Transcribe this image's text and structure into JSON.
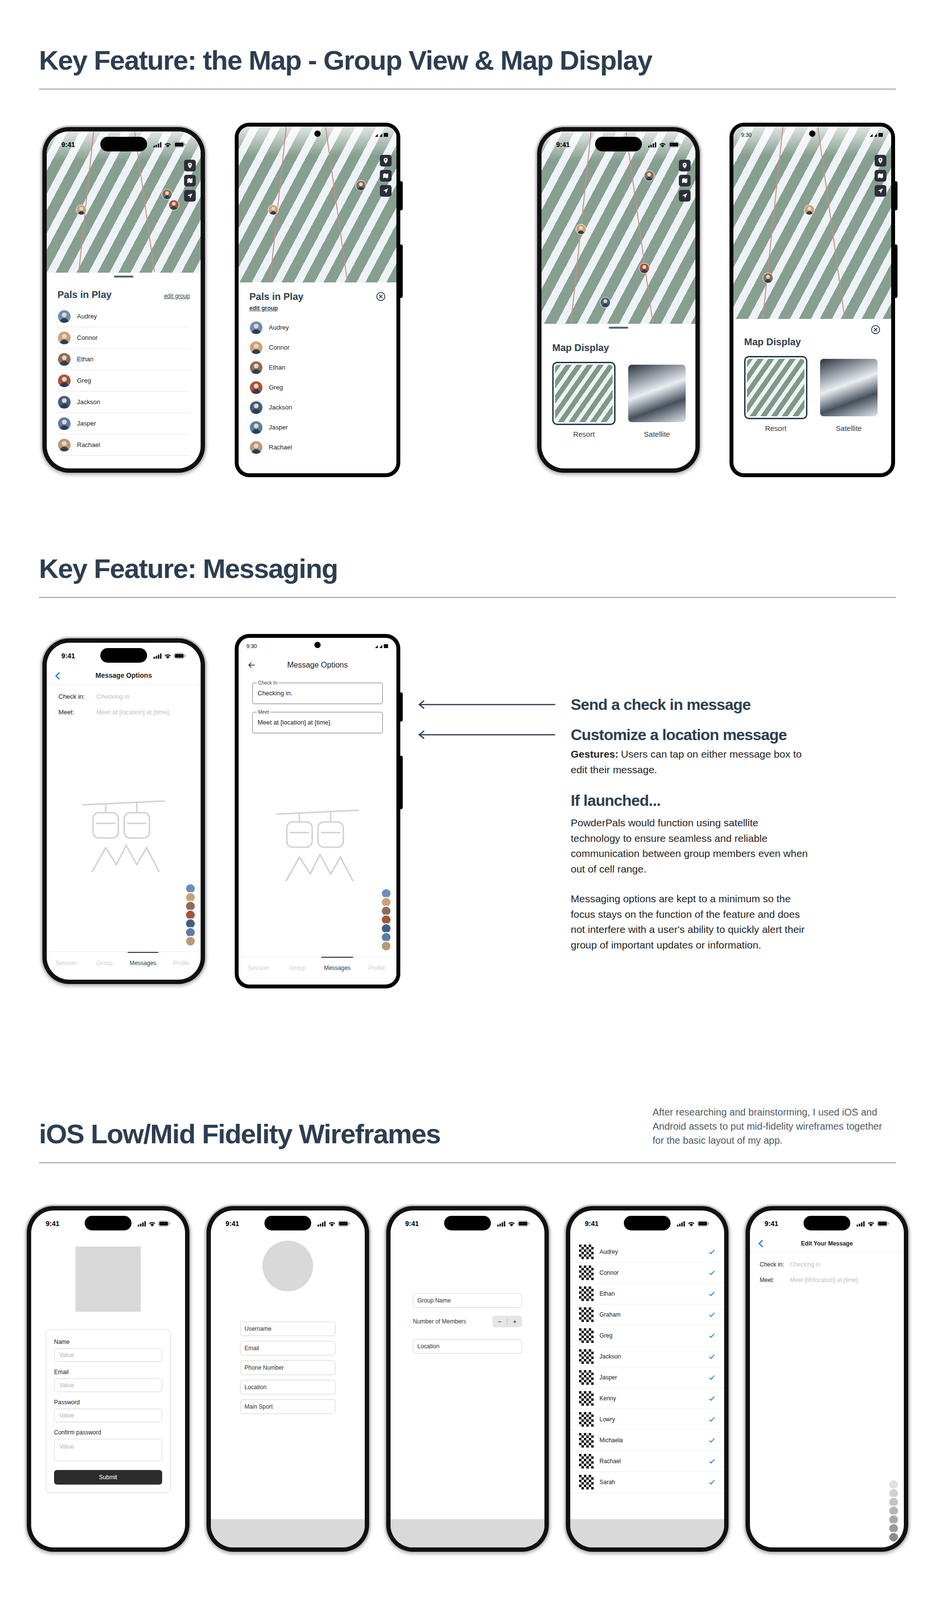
{
  "map_section": {
    "title": "Key Feature: the Map - Group View & Map Display",
    "phones": [
      {
        "kind": "ios",
        "view": "group",
        "status_time": "9:41",
        "sheet_title": "Pals in Play",
        "edit_link": "edit group",
        "members": [
          "Audrey",
          "Connor",
          "Ethan",
          "Greg",
          "Jackson",
          "Jasper",
          "Rachael"
        ]
      },
      {
        "kind": "android",
        "view": "group",
        "sheet_title": "Pals in Play",
        "edit_link": "edit group",
        "members": [
          "Audrey",
          "Connor",
          "Ethan",
          "Greg",
          "Jackson",
          "Jasper",
          "Rachael"
        ]
      },
      {
        "kind": "ios",
        "view": "display",
        "status_time": "9:41",
        "sheet_title": "Map Display",
        "options": [
          {
            "label": "Resort",
            "selected": true
          },
          {
            "label": "Satellite",
            "selected": false
          }
        ]
      },
      {
        "kind": "android",
        "view": "display",
        "status_time": "9:30",
        "sheet_title": "Map Display",
        "options": [
          {
            "label": "Resort",
            "selected": true
          },
          {
            "label": "Satellite",
            "selected": false
          }
        ]
      }
    ]
  },
  "messaging_section": {
    "title": "Key Feature: Messaging",
    "phones": [
      {
        "kind": "ios",
        "status_time": "9:41",
        "header": "Message Options",
        "fields": [
          {
            "label": "Check in:",
            "placeholder": "Checking in."
          },
          {
            "label": "Meet:",
            "placeholder": "Meet at [location] at [time]."
          }
        ],
        "tabs": [
          {
            "label": "Session",
            "selected": false
          },
          {
            "label": "Group",
            "selected": false
          },
          {
            "label": "Messages",
            "selected": true
          },
          {
            "label": "Profile",
            "selected": false
          }
        ]
      },
      {
        "kind": "android",
        "status_time": "9:30",
        "header": "Message Options",
        "fields": [
          {
            "label": "Check In",
            "value": "Checking in."
          },
          {
            "label": "Meet",
            "value": "Meet at [location] at [time]."
          }
        ],
        "tabs": [
          {
            "label": "Session",
            "selected": false
          },
          {
            "label": "Group",
            "selected": false
          },
          {
            "label": "Messages",
            "selected": true
          },
          {
            "label": "Profile",
            "selected": false
          }
        ]
      }
    ],
    "annotations": {
      "callouts": [
        "Send a check in message",
        "Customize a location message"
      ],
      "gesture_label": "Gestures:",
      "gesture_text": "Users can tap on either message box to edit their message.",
      "launch_title": "If launched...",
      "paragraphs": [
        "PowderPals would function using satellite technology to ensure seamless and reliable communication between group members even when out of cell range.",
        "Messaging options are kept to a minimum so the focus stays on the function of the feature and does not interfere with a user's ability to quickly alert their group of important updates or information."
      ]
    }
  },
  "wireframes_section": {
    "title": "iOS Low/Mid Fidelity Wireframes",
    "note": "After researching and brainstorming, I used iOS and Android assets to put mid-fidelity wireframes together for the basic layout of my app.",
    "phones": [
      {
        "kind": "signup",
        "status_time": "9:41",
        "fields": [
          {
            "label": "Name",
            "placeholder": "Value"
          },
          {
            "label": "Email",
            "placeholder": "Value"
          },
          {
            "label": "Password",
            "placeholder": "Value"
          },
          {
            "label": "Confirm password",
            "placeholder": "Value"
          }
        ],
        "button": "Submit"
      },
      {
        "kind": "profile",
        "status_time": "9:41",
        "fields": [
          "Username",
          "Email",
          "Phone Number",
          "Location",
          "Main Sport"
        ]
      },
      {
        "kind": "group",
        "status_time": "9:41",
        "group_name": "Group Name",
        "members_label": "Number of Members",
        "stepper": [
          "−",
          "+"
        ],
        "location": "Location"
      },
      {
        "kind": "members",
        "status_time": "9:41",
        "members": [
          {
            "name": "Audrey",
            "checked": true
          },
          {
            "name": "Connor",
            "checked": true
          },
          {
            "name": "Ethan",
            "checked": true
          },
          {
            "name": "Graham",
            "checked": true
          },
          {
            "name": "Greg",
            "checked": true
          },
          {
            "name": "Jackson",
            "checked": true
          },
          {
            "name": "Jasper",
            "checked": true
          },
          {
            "name": "Kenny",
            "checked": true
          },
          {
            "name": "Lowry",
            "checked": true
          },
          {
            "name": "Michaela",
            "checked": true
          },
          {
            "name": "Rachael",
            "checked": true
          },
          {
            "name": "Sarah",
            "checked": true
          }
        ]
      },
      {
        "kind": "message",
        "status_time": "9:41",
        "header": "Edit Your Message",
        "fields": [
          {
            "label": "Check in:",
            "placeholder": "Checking in."
          },
          {
            "label": "Meet:",
            "placeholder": "Meet [lift/location] at [time]."
          }
        ]
      }
    ]
  }
}
